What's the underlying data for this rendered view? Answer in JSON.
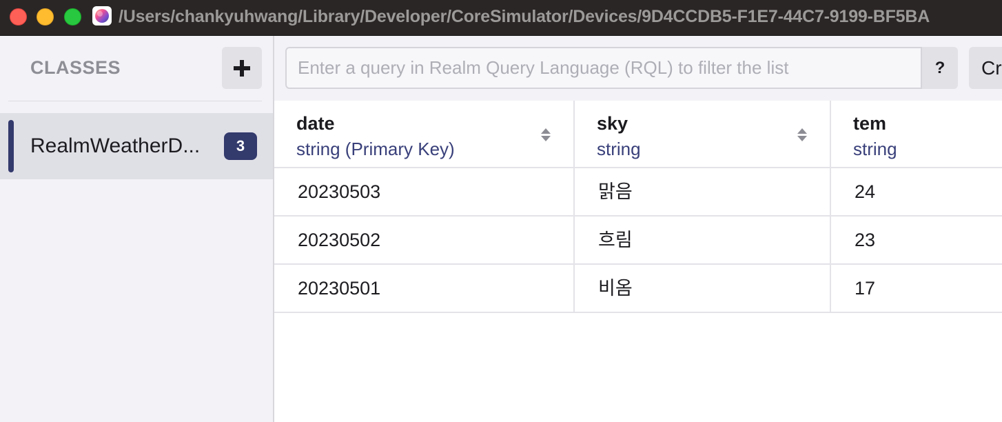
{
  "window": {
    "title": "/Users/chankyuhwang/Library/Developer/CoreSimulator/Devices/9D4CCDB5-F1E7-44C7-9199-BF5BA"
  },
  "sidebar": {
    "title": "CLASSES",
    "add_icon": "plus-icon",
    "classes": [
      {
        "name": "RealmWeatherD...",
        "count": "3"
      }
    ]
  },
  "toolbar": {
    "query_placeholder": "Enter a query in Realm Query Language (RQL) to filter the list",
    "help_label": "?",
    "create_label": "Cr"
  },
  "table": {
    "columns": [
      {
        "name": "date",
        "type": "string (Primary Key)",
        "sortable": true
      },
      {
        "name": "sky",
        "type": "string",
        "sortable": true
      },
      {
        "name": "tem",
        "type": "string",
        "sortable": false
      }
    ],
    "rows": [
      [
        "20230503",
        "맑음",
        "24"
      ],
      [
        "20230502",
        "흐림",
        "23"
      ],
      [
        "20230501",
        "비옴",
        "17"
      ]
    ]
  },
  "colors": {
    "accent": "#333a6c",
    "type_text": "#39407a",
    "close": "#fe5f57",
    "minimize": "#febc2e",
    "maximize": "#28c840"
  }
}
